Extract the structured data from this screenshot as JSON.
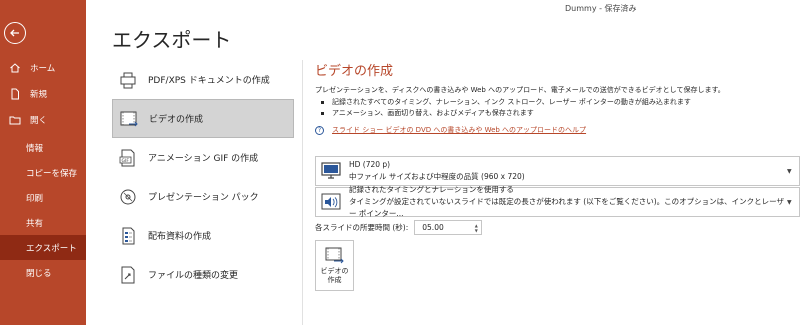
{
  "titlebar": {
    "document": "Dummy - 保存済み"
  },
  "sidebar": {
    "top_items": [
      {
        "label": "ホーム",
        "icon": "home-icon"
      },
      {
        "label": "新規",
        "icon": "new-document-icon"
      },
      {
        "label": "開く",
        "icon": "open-folder-icon"
      }
    ],
    "bottom_items": [
      {
        "label": "情報"
      },
      {
        "label": "コピーを保存"
      },
      {
        "label": "印刷"
      },
      {
        "label": "共有"
      },
      {
        "label": "エクスポート"
      },
      {
        "label": "閉じる"
      }
    ],
    "active_label": "エクスポート",
    "accent_color": "#b7472a"
  },
  "page": {
    "title": "エクスポート"
  },
  "options": [
    {
      "label": "PDF/XPS ドキュメントの作成",
      "icon": "pdf-xps-icon"
    },
    {
      "label": "ビデオの作成",
      "icon": "video-icon",
      "selected": true
    },
    {
      "label": "アニメーション GIF の作成",
      "icon": "gif-icon"
    },
    {
      "label": "プレゼンテーション パック",
      "icon": "disc-package-icon"
    },
    {
      "label": "配布資料の作成",
      "icon": "handout-icon"
    },
    {
      "label": "ファイルの種類の変更",
      "icon": "file-type-icon"
    }
  ],
  "panel": {
    "title": "ビデオの作成",
    "description": "プレゼンテーションを、ディスクへの書き込みや Web へのアップロード、電子メールでの送信ができるビデオとして保存します。",
    "bullets": [
      "記録されたすべてのタイミング、ナレーション、インク ストローク、レーザー ポインターの動きが組み込まれます",
      "アニメーション、画面切り替え、およびメディアも保存されます"
    ],
    "help_link": "スライド ショー ビデオの DVD への書き込みや Web へのアップロードのヘルプ",
    "quality": {
      "line1": "HD (720 p)",
      "line2": "中ファイル サイズおよび中程度の品質 (960 x 720)"
    },
    "timing": {
      "line1": "記録されたタイミングとナレーションを使用する",
      "line2": "タイミングが設定されていないスライドでは既定の長さが使われます (以下をご覧ください)。このオプションは、インクとレーザー ポインター..."
    },
    "seconds_label": "各スライドの所要時間 (秒):",
    "seconds_value": "05.00",
    "create_button": "ビデオの作成"
  }
}
